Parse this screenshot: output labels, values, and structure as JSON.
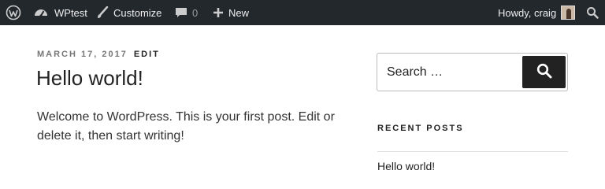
{
  "admin_bar": {
    "site_name": "WPtest",
    "customize_label": "Customize",
    "comments_count": "0",
    "new_label": "New",
    "howdy_text": "Howdy, craig",
    "icons": [
      "wordpress-logo-icon",
      "dashboard-icon",
      "brush-icon",
      "comment-icon",
      "plus-icon",
      "search-icon"
    ]
  },
  "post": {
    "date": "March 17, 2017",
    "edit_label": "Edit",
    "title": "Hello world!",
    "body": "Welcome to WordPress. This is your first post. Edit or delete it, then start writing!"
  },
  "sidebar": {
    "search": {
      "placeholder": "Search …"
    },
    "recent_posts": {
      "title": "Recent Posts",
      "items": [
        {
          "label": "Hello world!"
        }
      ]
    }
  },
  "colors": {
    "admin_bar_bg": "#23282d",
    "button_bg": "#222222",
    "meta_grey": "#767676"
  }
}
